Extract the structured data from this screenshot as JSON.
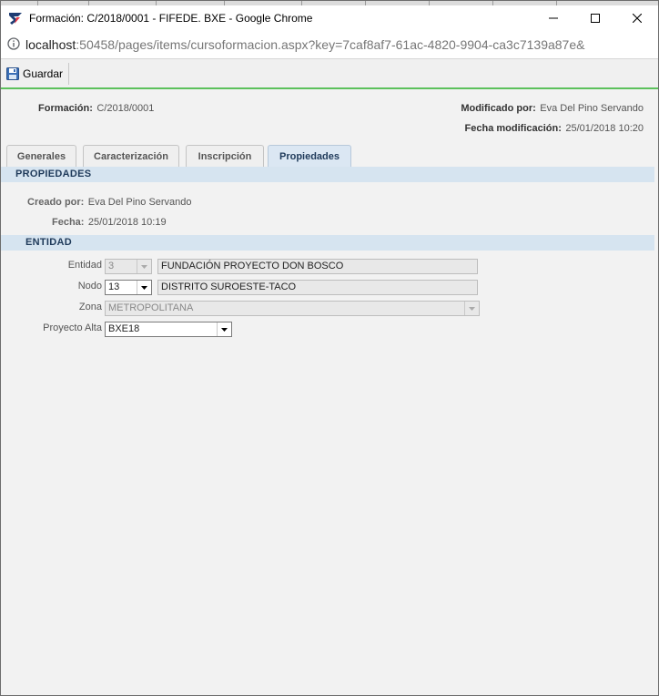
{
  "window": {
    "title": "Formación: C/2018/0001 - FIFEDE. BXE - Google Chrome"
  },
  "address": {
    "host": "localhost",
    "rest": ":50458/pages/items/cursoformacion.aspx?key=7caf8af7-61ac-4820-9904-ca3c7139a87e&"
  },
  "toolbar": {
    "save_label": "Guardar"
  },
  "header": {
    "formacion_label": "Formación:",
    "formacion_value": "C/2018/0001",
    "modificado_label": "Modificado por:",
    "modificado_value": "Eva Del Pino Servando",
    "fecha_mod_label": "Fecha modificación:",
    "fecha_mod_value": "25/01/2018 10:20"
  },
  "tabs": [
    {
      "label": "Generales"
    },
    {
      "label": "Caracterización"
    },
    {
      "label": "Inscripción"
    },
    {
      "label": "Propiedades"
    }
  ],
  "propiedades": {
    "section_title": "PROPIEDADES",
    "creado_label": "Creado por:",
    "creado_value": "Eva Del Pino Servando",
    "fecha_label": "Fecha:",
    "fecha_value": "25/01/2018 10:19"
  },
  "entidad": {
    "section_title": "ENTIDAD",
    "entidad_label": "Entidad",
    "entidad_code": "3",
    "entidad_name": "FUNDACIÓN PROYECTO DON BOSCO",
    "nodo_label": "Nodo",
    "nodo_code": "13",
    "nodo_name": "DISTRITO SUROESTE-TACO",
    "zona_label": "Zona",
    "zona_value": "METROPOLITANA",
    "proyecto_label": "Proyecto Alta",
    "proyecto_value": "BXE18"
  },
  "icons": {
    "app": "app-logo-icon",
    "info": "info-icon",
    "save": "floppy-disk-icon",
    "dropdown": "chevron-down-icon"
  },
  "colors": {
    "accent_line": "#5cc15c",
    "section_bg": "#d6e4f0",
    "active_tab": "#dbe7f3"
  }
}
